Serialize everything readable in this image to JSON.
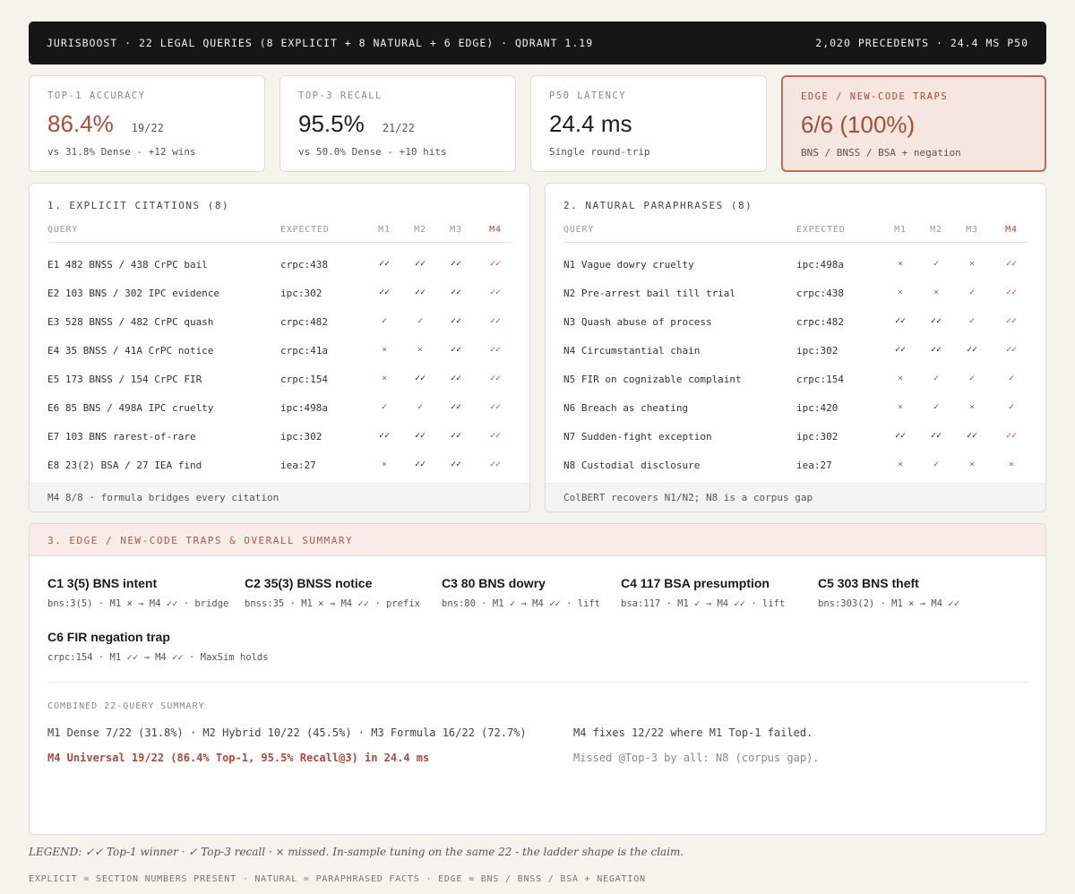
{
  "header": {
    "left": "JURISBOOST · 22 LEGAL QUERIES (8 EXPLICIT + 8 NATURAL + 6 EDGE) · QDRANT 1.19",
    "right": "2,020 PRECEDENTS · 24.4 MS P50"
  },
  "stats": [
    {
      "label": "TOP-1 ACCURACY",
      "value": "86.4%",
      "fraction": "19/22",
      "sub": "vs 31.8% Dense - +12 wins"
    },
    {
      "label": "TOP-3 RECALL",
      "value": "95.5%",
      "fraction": "21/22",
      "sub": "vs 50.0% Dense - +10 hits"
    },
    {
      "label": "P50 LATENCY",
      "value": "24.4 ms",
      "fraction": "",
      "sub": "Single round-trip"
    },
    {
      "label": "EDGE / NEW-CODE TRAPS",
      "value": "6/6 (100%)",
      "fraction": "",
      "sub": "BNS / BNSS / BSA + negation"
    }
  ],
  "columns": {
    "query": "QUERY",
    "expected": "EXPECTED",
    "m1": "M1",
    "m2": "M2",
    "m3": "M3",
    "m4": "M4"
  },
  "marks": {
    "win": "✓✓",
    "recall": "✓",
    "miss": "×"
  },
  "panel1": {
    "title": "1. EXPLICIT CITATIONS (8)",
    "rows": [
      {
        "q": "E1 482 BNSS / 438 CrPC bail",
        "e": "crpc:438",
        "m": [
          "win",
          "win",
          "win",
          "win"
        ]
      },
      {
        "q": "E2 103 BNS / 302 IPC evidence",
        "e": "ipc:302",
        "m": [
          "win",
          "win",
          "win",
          "win"
        ]
      },
      {
        "q": "E3 528 BNSS / 482 CrPC quash",
        "e": "crpc:482",
        "m": [
          "recall",
          "recall",
          "win",
          "win"
        ]
      },
      {
        "q": "E4 35 BNSS / 41A CrPC notice",
        "e": "crpc:41a",
        "m": [
          "miss",
          "miss",
          "win",
          "win"
        ]
      },
      {
        "q": "E5 173 BNSS / 154 CrPC FIR",
        "e": "crpc:154",
        "m": [
          "miss",
          "win",
          "win",
          "win"
        ]
      },
      {
        "q": "E6 85 BNS / 498A IPC cruelty",
        "e": "ipc:498a",
        "m": [
          "recall",
          "recall",
          "win",
          "win"
        ]
      },
      {
        "q": "E7 103 BNS rarest-of-rare",
        "e": "ipc:302",
        "m": [
          "win",
          "win",
          "win",
          "win"
        ]
      },
      {
        "q": "E8 23(2) BSA / 27 IEA find",
        "e": "iea:27",
        "m": [
          "miss",
          "win",
          "win",
          "win"
        ]
      }
    ],
    "footer": "M4 8/8 · formula bridges every citation"
  },
  "panel2": {
    "title": "2. NATURAL PARAPHRASES (8)",
    "rows": [
      {
        "q": "N1 Vague dowry cruelty",
        "e": "ipc:498a",
        "m": [
          "miss",
          "recall",
          "miss",
          "win"
        ]
      },
      {
        "q": "N2 Pre-arrest bail till trial",
        "e": "crpc:438",
        "m": [
          "miss",
          "miss",
          "recall",
          "win"
        ]
      },
      {
        "q": "N3 Quash abuse of process",
        "e": "crpc:482",
        "m": [
          "win",
          "win",
          "recall",
          "win"
        ]
      },
      {
        "q": "N4 Circumstantial chain",
        "e": "ipc:302",
        "m": [
          "win",
          "win",
          "win",
          "win"
        ]
      },
      {
        "q": "N5 FIR on cognizable complaint",
        "e": "crpc:154",
        "m": [
          "miss",
          "recall",
          "recall",
          "recall"
        ]
      },
      {
        "q": "N6 Breach as cheating",
        "e": "ipc:420",
        "m": [
          "miss",
          "recall",
          "miss",
          "recall"
        ]
      },
      {
        "q": "N7 Sudden-fight exception",
        "e": "ipc:302",
        "m": [
          "win",
          "win",
          "win",
          "win"
        ]
      },
      {
        "q": "N8 Custodial disclosure",
        "e": "iea:27",
        "m": [
          "miss",
          "recall",
          "miss",
          "miss"
        ]
      }
    ],
    "footer": "ColBERT recovers N1/N2; N8 is a corpus gap"
  },
  "section3": {
    "title": "3. EDGE / NEW-CODE TRAPS & OVERALL SUMMARY",
    "traps": [
      {
        "title": "C1 3(5) BNS intent",
        "detail": "bns:3(5) · M1 × → M4 ✓✓ · bridge"
      },
      {
        "title": "C2 35(3) BNSS notice",
        "detail": "bnss:35 · M1 × → M4 ✓✓ · prefix"
      },
      {
        "title": "C3 80 BNS dowry",
        "detail": "bns:80 · M1 ✓ → M4 ✓✓ · lift"
      },
      {
        "title": "C4 117 BSA presumption",
        "detail": "bsa:117 · M1 ✓ → M4 ✓✓ · lift"
      },
      {
        "title": "C5 303 BNS theft",
        "detail": "bns:303(2) · M1 × → M4 ✓✓"
      },
      {
        "title": "C6 FIR negation trap",
        "detail": "crpc:154 · M1 ✓✓ → M4 ✓✓ · MaxSim holds"
      }
    ],
    "combined_title": "COMBINED 22-QUERY SUMMARY",
    "line1": "M1 Dense 7/22 (31.8%) · M2 Hybrid 10/22 (45.5%) · M3 Formula 16/22 (72.7%)",
    "line2": "M4 Universal 19/22 (86.4% Top-1, 95.5% Recall@3) in 24.4 ms",
    "line3": "M4 fixes 12/22 where M1 Top-1 failed.",
    "line4": "Missed @Top-3 by all: N8 (corpus gap)."
  },
  "legend": "LEGEND: ✓✓ Top-1 winner · ✓ Top-3 recall · × missed. In-sample tuning on the same 22 - the ladder shape is the claim.",
  "footnote": "EXPLICIT = SECTION NUMBERS PRESENT · NATURAL = PARAPHRASED FACTS · EDGE = BNS / BNSS / BSA + NEGATION",
  "colors": {
    "accent": "#a94b3c",
    "miss": "#c0584a",
    "dark": "#161616",
    "background": "#f4f3ec"
  }
}
